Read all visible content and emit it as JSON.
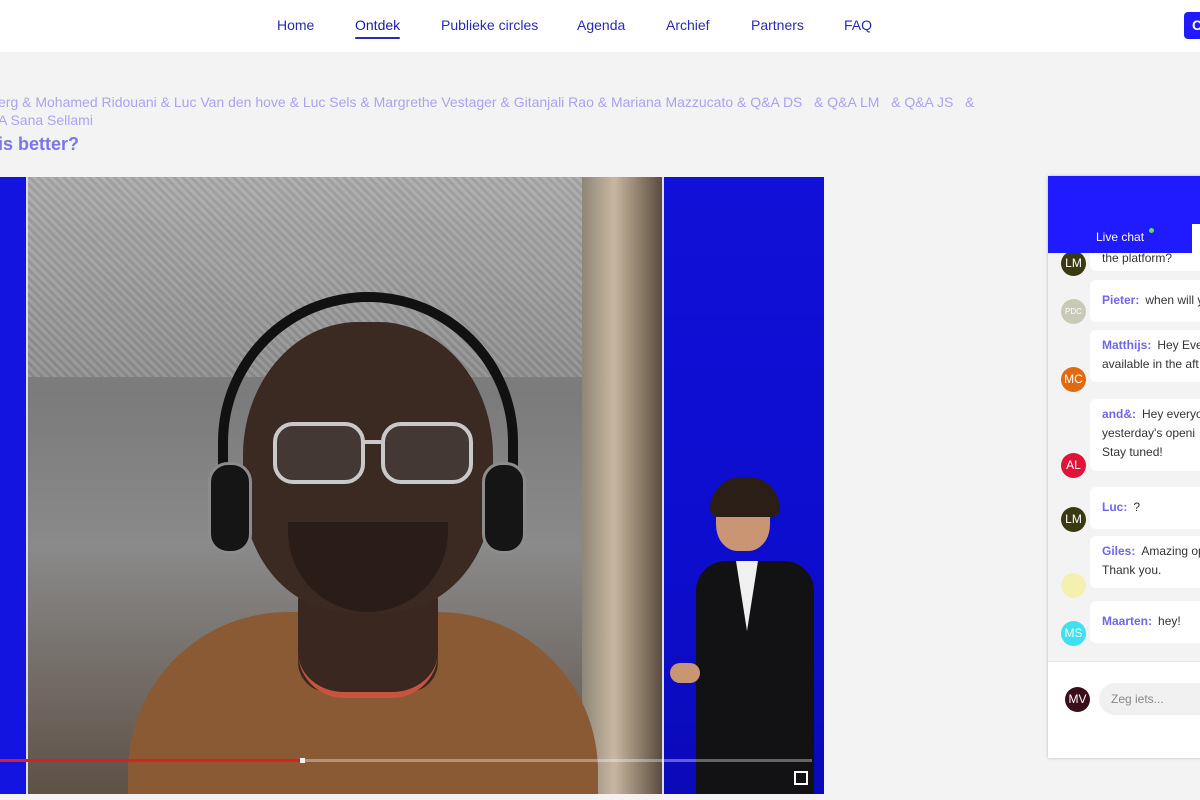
{
  "nav": {
    "items": [
      {
        "label": "Home"
      },
      {
        "label": "Ontdek",
        "active": true
      },
      {
        "label": "Publieke circles"
      },
      {
        "label": "Agenda"
      },
      {
        "label": "Archief"
      },
      {
        "label": "Partners"
      },
      {
        "label": "FAQ"
      }
    ],
    "cta_label": "C",
    "accent": "#1f1aff"
  },
  "session": {
    "speakers_line1": "erg & Mohamed Ridouani & Luc Van den hove & Luc Sels & Margrethe Vestager & Gitanjali Rao & Mariana Mazzucato & Q&A DS   & Q&A LM   & Q&A JS   &",
    "speakers_line2": "A Sana Sellami",
    "title": "is better?"
  },
  "video": {
    "progress_fraction": 0.37,
    "fullscreen_icon": "fullscreen-icon"
  },
  "chat": {
    "tab_label": "Live chat",
    "messages": [
      {
        "initials": "LM",
        "avatar_color": "#3a3a12",
        "author": "",
        "text": "the platform?"
      },
      {
        "initials": "PDC",
        "avatar_color": "#c9c9b8",
        "author": "Pieter:",
        "text": "when will y"
      },
      {
        "initials": "MC",
        "avatar_color": "#e06a10",
        "author": "Matthijs:",
        "text": "Hey Eve",
        "text2": "available in the aft"
      },
      {
        "initials": "AL",
        "avatar_color": "#e0143a",
        "author": "and&:",
        "text": "Hey everyo",
        "text2": "yesterday's openi",
        "text3": "Stay tuned!"
      },
      {
        "initials": "LM",
        "avatar_color": "#3a3a12",
        "author": "Luc:",
        "text": "?"
      },
      {
        "initials": "",
        "avatar_color": "#f4f0b0",
        "author": "Giles:",
        "text": "Amazing op",
        "text2": "Thank you."
      },
      {
        "initials": "MS",
        "avatar_color": "#3fe0f0",
        "author": "Maarten:",
        "text": "hey!"
      }
    ],
    "me_initials": "MV",
    "input_placeholder": "Zeg iets..."
  }
}
